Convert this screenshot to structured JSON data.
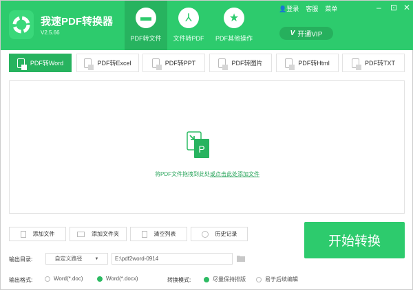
{
  "app": {
    "title": "我速PDF转换器",
    "version": "V2.5.66"
  },
  "nav": [
    {
      "label": "PDF转文件",
      "icon": "folder-icon",
      "active": true
    },
    {
      "label": "文件转PDF",
      "icon": "pdf-icon",
      "active": false
    },
    {
      "label": "PDF其他操作",
      "icon": "star-icon",
      "active": false
    }
  ],
  "toplinks": {
    "login": "登录",
    "service": "客服",
    "menu": "菜单"
  },
  "vip": {
    "label": "开通VIP",
    "badge": "V"
  },
  "conv_tabs": [
    {
      "label": "PDF转Word"
    },
    {
      "label": "PDF转Excel"
    },
    {
      "label": "PDF转PPT"
    },
    {
      "label": "PDF转图片"
    },
    {
      "label": "PDF转Html"
    },
    {
      "label": "PDF转TXT"
    }
  ],
  "drop": {
    "text_a": "将PDF文件拖拽到此处",
    "text_b": "或点击此处添加文件",
    "icon_letter": "P"
  },
  "actions": [
    {
      "label": "添加文件"
    },
    {
      "label": "添加文件夹"
    },
    {
      "label": "清空列表"
    },
    {
      "label": "历史记录"
    }
  ],
  "start": "开始转换",
  "output": {
    "label": "输出目录:",
    "mode": "自定义路径",
    "path": "E:\\pdf2word-0914"
  },
  "format": {
    "label": "输出格式:",
    "options": [
      "Word(*.doc)",
      "Word(*.docx)"
    ],
    "selected": 1
  },
  "convmode": {
    "label": "转换模式:",
    "options": [
      "尽量保持排版",
      "易于后续编辑"
    ],
    "selected": 0
  },
  "colors": {
    "brand": "#2dcb6d",
    "active": "#27b35f"
  }
}
